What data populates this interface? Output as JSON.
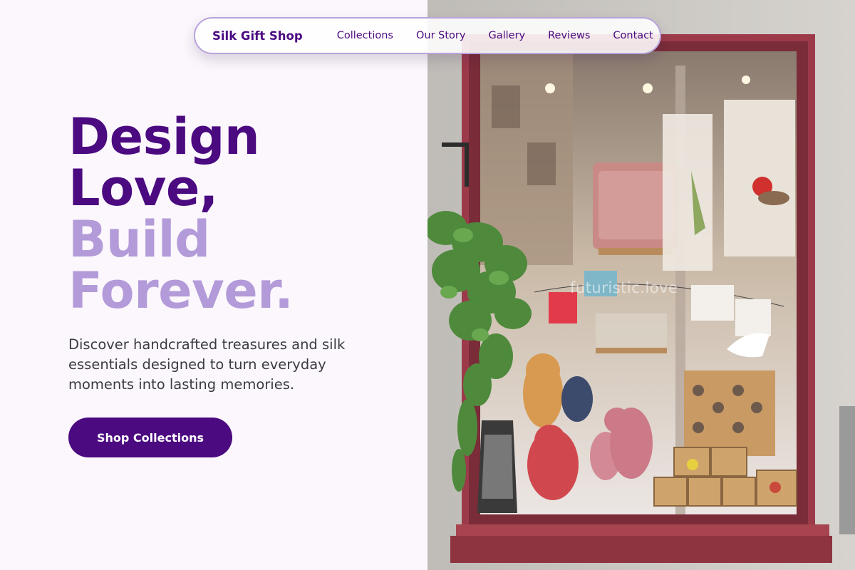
{
  "nav": {
    "brand": "Silk Gift Shop",
    "links": [
      "Collections",
      "Our Story",
      "Gallery",
      "Reviews",
      "Contact"
    ]
  },
  "hero": {
    "title_lines_dark": [
      "Design",
      "Love,"
    ],
    "title_lines_light": [
      "Build",
      "Forever."
    ],
    "subtitle": "Discover handcrafted treasures and silk essentials designed to turn everyday moments into lasting memories.",
    "cta_label": "Shop Collections"
  },
  "image": {
    "watermark": "futuristic.love"
  },
  "colors": {
    "brand_dark": "#4b0a80",
    "brand_light": "#b39ad9",
    "page_background": "#fbf7fc",
    "body_text": "#3b3b44",
    "window_frame": "#9c3a4a"
  }
}
